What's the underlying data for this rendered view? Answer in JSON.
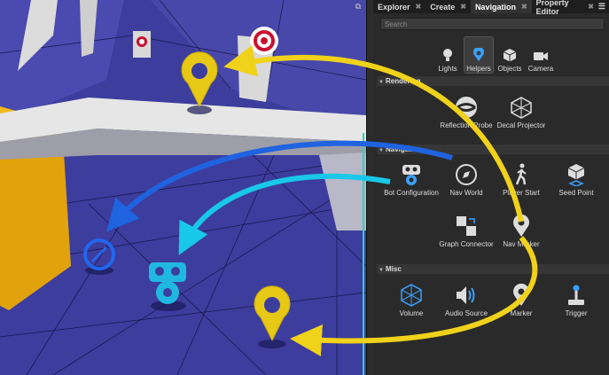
{
  "tabs": [
    {
      "label": "Explorer",
      "active": false
    },
    {
      "label": "Create",
      "active": false
    },
    {
      "label": "Navigation",
      "active": true
    },
    {
      "label": "Property Editor",
      "active": false
    }
  ],
  "tab_close_glyph": "✖",
  "menu_glyph": "☰",
  "search": {
    "placeholder": "Search"
  },
  "categories": [
    {
      "label": "Lights",
      "icon": "bulb-icon"
    },
    {
      "label": "Helpers",
      "icon": "pin-icon",
      "active": true
    },
    {
      "label": "Objects",
      "icon": "cube-icon"
    },
    {
      "label": "Camera",
      "icon": "camera-icon"
    }
  ],
  "sections": {
    "rendering": {
      "title": "Rendering",
      "items": [
        {
          "label": "Reflection Probe",
          "icon": "reflection-probe-icon"
        },
        {
          "label": "Decal Projector",
          "icon": "decal-projector-icon"
        }
      ]
    },
    "navigation": {
      "title": "Navigation",
      "items": [
        {
          "label": "Bot Configuration",
          "icon": "bot-icon"
        },
        {
          "label": "Nav World",
          "icon": "compass-icon"
        },
        {
          "label": "Player Start",
          "icon": "walking-person-icon"
        },
        {
          "label": "Seed Point",
          "icon": "seed-cube-icon"
        },
        {
          "label": "Graph Connector",
          "icon": "graph-connector-icon"
        },
        {
          "label": "Nav Marker",
          "icon": "map-pin-icon"
        }
      ]
    },
    "misc": {
      "title": "Misc",
      "items": [
        {
          "label": "Volume",
          "icon": "volume-icon"
        },
        {
          "label": "Audio Source",
          "icon": "speaker-icon"
        },
        {
          "label": "Marker",
          "icon": "marker-pin-icon"
        },
        {
          "label": "Trigger",
          "icon": "joystick-icon"
        }
      ]
    }
  },
  "colors": {
    "arrow_yellow": "#f0d21a",
    "arrow_blue": "#1f63e0",
    "arrow_cyan": "#18c8e8",
    "viewport_floor": "#3c3c9a",
    "panel_bg": "#2a2a2a"
  }
}
